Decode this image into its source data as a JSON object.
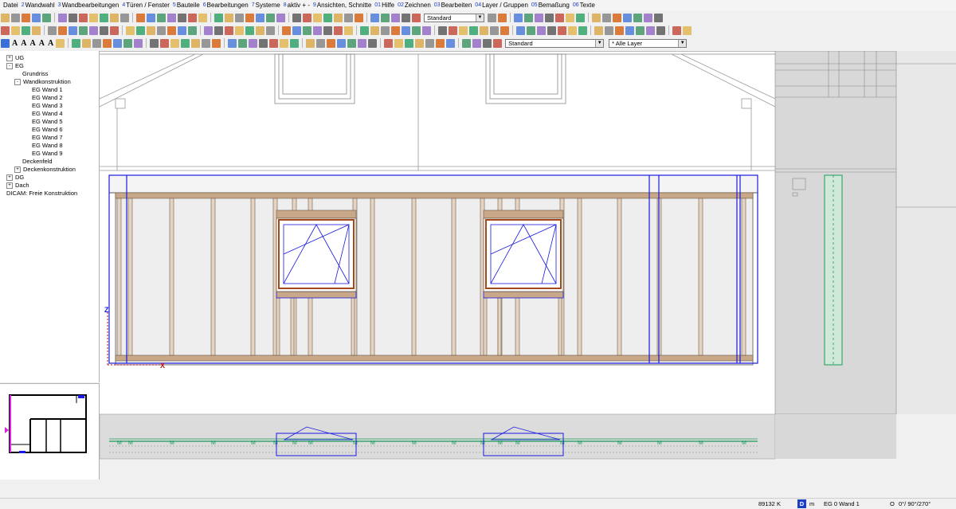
{
  "menu": [
    {
      "num": "",
      "label": "Datei"
    },
    {
      "num": "2",
      "label": "Wandwahl"
    },
    {
      "num": "3",
      "label": "Wandbearbeitungen"
    },
    {
      "num": "4",
      "label": "Türen / Fenster"
    },
    {
      "num": "5",
      "label": "Bauteile"
    },
    {
      "num": "6",
      "label": "Bearbeitungen"
    },
    {
      "num": "7",
      "label": "Systeme"
    },
    {
      "num": "8",
      "label": "aktiv + -"
    },
    {
      "num": "9",
      "label": "Ansichten, Schnitte"
    },
    {
      "num": "01",
      "label": "Hilfe"
    },
    {
      "num": "02",
      "label": "Zeichnen"
    },
    {
      "num": "03",
      "label": "Bearbeiten"
    },
    {
      "num": "04",
      "label": "Layer / Gruppen"
    },
    {
      "num": "05",
      "label": "Bemaßung"
    },
    {
      "num": "06",
      "label": "Texte"
    }
  ],
  "toolbar": {
    "style_select": "Standard",
    "standard_select": "Standard",
    "layer_select": "* Alle Layer",
    "font_buttons": [
      "A",
      "A",
      "A",
      "A",
      "A"
    ]
  },
  "tree": [
    {
      "label": "UG",
      "expander": "+"
    },
    {
      "label": "EG",
      "expander": "-"
    },
    {
      "label": "Grundriss",
      "expander": ""
    },
    {
      "label": "Wandkonstruktion",
      "expander": "-"
    },
    {
      "label": "EG Wand 1",
      "expander": ""
    },
    {
      "label": "EG Wand 2",
      "expander": ""
    },
    {
      "label": "EG Wand 3",
      "expander": ""
    },
    {
      "label": "EG Wand 4",
      "expander": ""
    },
    {
      "label": "EG Wand 5",
      "expander": ""
    },
    {
      "label": "EG Wand 6",
      "expander": ""
    },
    {
      "label": "EG Wand 7",
      "expander": ""
    },
    {
      "label": "EG Wand 8",
      "expander": ""
    },
    {
      "label": "EG Wand 9",
      "expander": ""
    },
    {
      "label": "Deckenfeld",
      "expander": ""
    },
    {
      "label": "Deckenkonstruktion",
      "expander": "+"
    },
    {
      "label": "DG",
      "expander": "+"
    },
    {
      "label": "Dach",
      "expander": "+"
    },
    {
      "label": "DICAM: Freie Konstruktion",
      "expander": ""
    }
  ],
  "axes": {
    "z": "Z",
    "x": "X"
  },
  "status": {
    "coord": "89132 K",
    "d_badge": "D",
    "unit": "m",
    "wall": "EG 0 Wand 1",
    "o_label": "O",
    "angles": "0°/ 90°/270°"
  },
  "colors": {
    "stud": "#c9a88a",
    "stud_edge": "#6b5a4a",
    "selection": "#1a1ae0",
    "window_frame": "#a3481a",
    "plan_green": "#1a9a5a",
    "nav_magenta": "#e020e0"
  }
}
